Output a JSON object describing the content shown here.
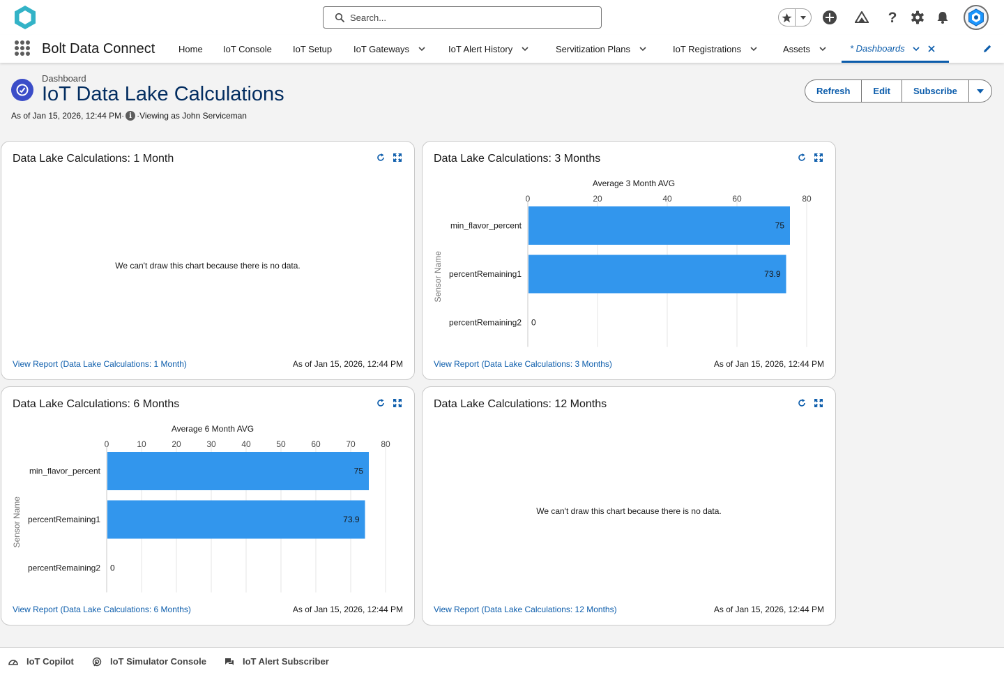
{
  "header": {
    "search_placeholder": "Search..."
  },
  "nav": {
    "app_name": "Bolt Data Connect",
    "items": [
      {
        "label": "Home"
      },
      {
        "label": "IoT Console"
      },
      {
        "label": "IoT Setup"
      },
      {
        "label": "IoT Gateways"
      },
      {
        "label": "IoT Alert History"
      },
      {
        "label": "Servitization Plans"
      },
      {
        "label": "IoT Registrations"
      },
      {
        "label": "Assets"
      },
      {
        "label": "* Dashboards"
      }
    ]
  },
  "page": {
    "object_label": "Dashboard",
    "title": "IoT Data Lake Calculations",
    "as_of": "As of Jan 15, 2026, 12:44 PM·",
    "viewing_as": "·Viewing as John Serviceman",
    "buttons": {
      "refresh": "Refresh",
      "edit": "Edit",
      "subscribe": "Subscribe"
    }
  },
  "cards": [
    {
      "title": "Data Lake Calculations: 1 Month",
      "no_data": "We can't draw this chart because there is no data.",
      "link": "View Report (Data Lake Calculations: 1 Month)",
      "as_of": "As of Jan 15, 2026, 12:44 PM"
    },
    {
      "title": "Data Lake Calculations: 3 Months",
      "link": "View Report (Data Lake Calculations: 3 Months)",
      "as_of": "As of Jan 15, 2026, 12:44 PM"
    },
    {
      "title": "Data Lake Calculations: 6 Months",
      "link": "View Report (Data Lake Calculations: 6 Months)",
      "as_of": "As of Jan 15, 2026, 12:44 PM"
    },
    {
      "title": "Data Lake Calculations: 12 Months",
      "no_data": "We can't draw this chart because there is no data.",
      "link": "View Report (Data Lake Calculations: 12 Months)",
      "as_of": "As of Jan 15, 2026, 12:44 PM"
    }
  ],
  "chart_data": [
    {
      "type": "bar",
      "orientation": "horizontal",
      "title": "Average 3 Month AVG",
      "ylabel": "Sensor Name",
      "xlabel": "",
      "categories": [
        "min_flavor_percent",
        "percentRemaining1",
        "percentRemaining2"
      ],
      "values": [
        75,
        73.9,
        0
      ],
      "value_labels": [
        "75",
        "73.9",
        "0"
      ],
      "xlim": [
        0,
        80
      ],
      "ticks": [
        0,
        20,
        40,
        60,
        80
      ],
      "grid": true,
      "color": "#3296ed"
    },
    {
      "type": "bar",
      "orientation": "horizontal",
      "title": "Average 6 Month AVG",
      "ylabel": "Sensor Name",
      "xlabel": "",
      "categories": [
        "min_flavor_percent",
        "percentRemaining1",
        "percentRemaining2"
      ],
      "values": [
        75,
        73.9,
        0
      ],
      "value_labels": [
        "75",
        "73.9",
        "0"
      ],
      "xlim": [
        0,
        80
      ],
      "ticks": [
        0,
        10,
        20,
        30,
        40,
        50,
        60,
        70,
        80
      ],
      "grid": true,
      "color": "#3296ed"
    }
  ],
  "utility_bar": {
    "items": [
      {
        "label": "IoT Copilot"
      },
      {
        "label": "IoT Simulator Console"
      },
      {
        "label": "IoT Alert Subscriber"
      }
    ]
  },
  "colors": {
    "brand_blue": "#0b5cab",
    "title_navy": "#032d60",
    "bar_blue": "#3296ed",
    "page_bg": "#f3f3f3",
    "dashboard_icon": "#3b4dc8"
  }
}
